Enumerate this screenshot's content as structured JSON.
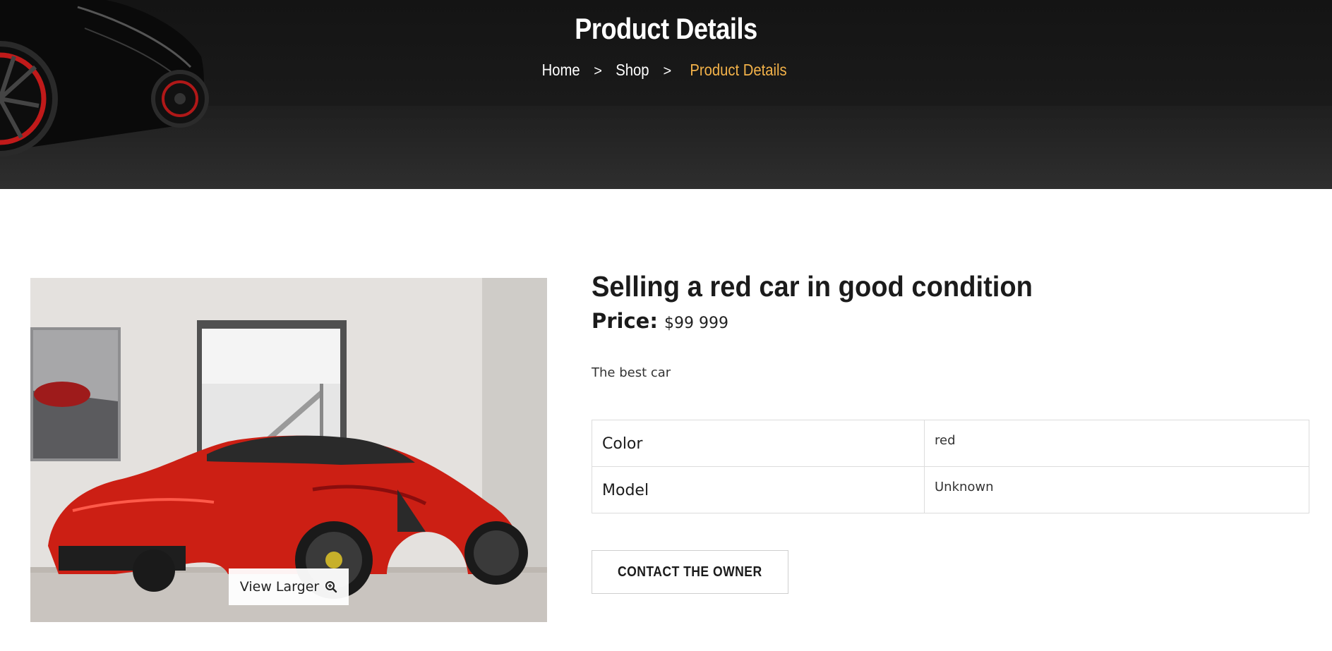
{
  "hero": {
    "title": "Product Details",
    "breadcrumb": {
      "home": "Home",
      "shop": "Shop",
      "current": "Product Details",
      "separator": ">"
    },
    "active_color": "#f3b249"
  },
  "product": {
    "title": "Selling a red car in good condition",
    "price_label": "Price:",
    "price_value": "$99 999",
    "description": "The best car",
    "view_larger_label": "View Larger",
    "specs": [
      {
        "key": "Color",
        "value": "red"
      },
      {
        "key": "Model",
        "value": "Unknown"
      }
    ],
    "contact_label": "CONTACT THE OWNER"
  },
  "icons": {
    "zoom": "zoom-in-icon"
  }
}
